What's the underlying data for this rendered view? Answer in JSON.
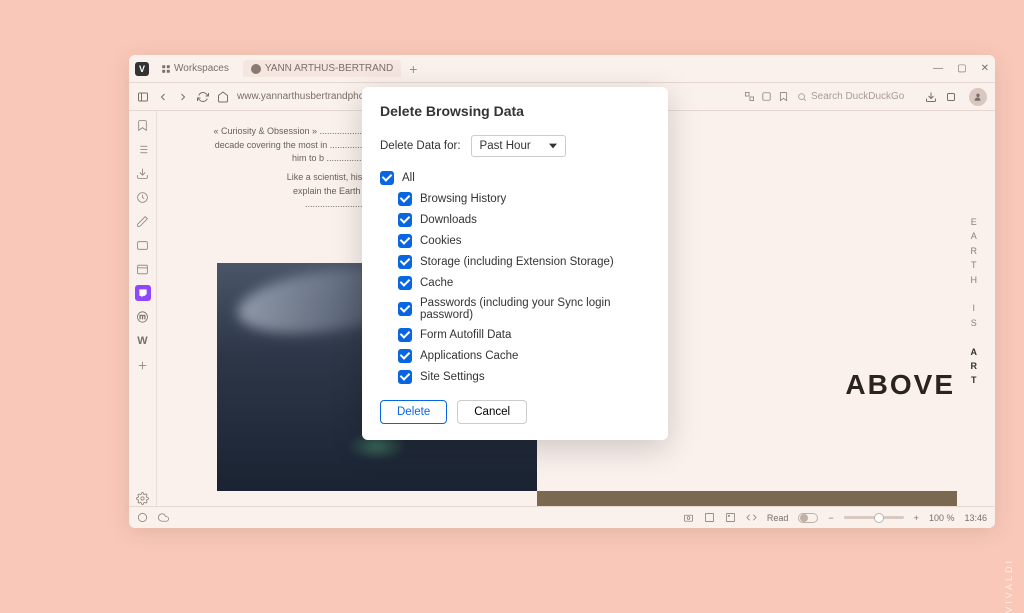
{
  "titlebar": {
    "logo": "V",
    "workspaces": "Workspaces",
    "tab_title": "YANN ARTHUS-BERTRAND"
  },
  "addrbar": {
    "url": "www.yannarthusbertrandphoto.com/work/",
    "search_placeholder": "Search DuckDuckGo"
  },
  "page": {
    "para1": "« Curiosity & Obsession » ......................... the same family of lions, a decade covering the most in ......................... and \"Horses\" which led him to b ......................... now.",
    "para3": "Like a scientist, his photogra ......................... as to explain the Earth and its phenomena in an artis ......................... rty years of photography.",
    "vtext_plain": "EARTH IS",
    "vtext_bold": "ART",
    "above": "ABOVE"
  },
  "dialog": {
    "title": "Delete Browsing Data",
    "for_label": "Delete Data for:",
    "range": "Past Hour",
    "all": "All",
    "items": [
      "Browsing History",
      "Downloads",
      "Cookies",
      "Storage (including Extension Storage)",
      "Cache",
      "Passwords (including your Sync login password)",
      "Form Autofill Data",
      "Applications Cache",
      "Site Settings"
    ],
    "delete_btn": "Delete",
    "cancel_btn": "Cancel"
  },
  "statusbar": {
    "read": "Read",
    "zoom": "100 %",
    "time": "13:46"
  },
  "brand": "VIVALDI"
}
